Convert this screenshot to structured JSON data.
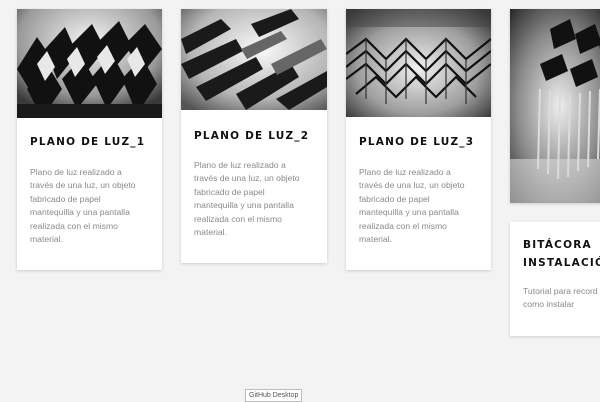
{
  "cards": [
    {
      "title": "PLANO DE LUZ_1",
      "text": "Plano de luz realizado a través de una luz, un objeto fabricado de papel mantequilla y una pantalla realizada con el mismo material."
    },
    {
      "title": "PLANO DE LUZ_2",
      "text": "Plano de luz realizado a través de una luz, un objeto fabricado de papel mantequilla y una pantalla realizada con el mismo material."
    },
    {
      "title": "PLANO DE LUZ_3",
      "text": "Plano de luz realizado a través de una luz, un objeto fabricado de papel mantequilla y una pantalla realizada con el mismo material."
    },
    {
      "title": "BITÁCORA\nINSTALACIÓN",
      "text": "Tutorial para record paso como instalar"
    }
  ],
  "tooltip": "GitHub Desktop"
}
